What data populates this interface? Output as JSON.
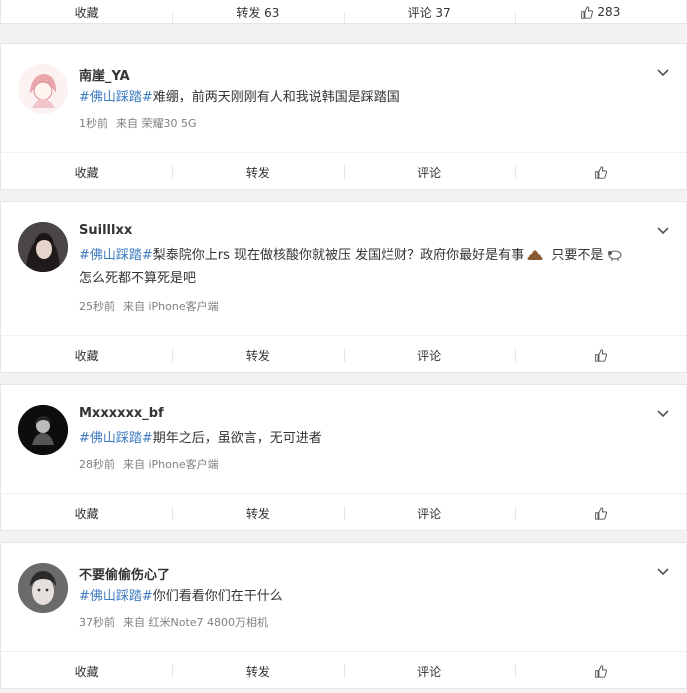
{
  "top_actions": {
    "favorite": "收藏",
    "repost": "转发 63",
    "comment": "评论 37",
    "like": "283"
  },
  "posts": [
    {
      "username": "南崖_YA",
      "hashtag": "#佛山踩踏#",
      "text": "难绷，前两天刚刚有人和我说韩国是踩踏国",
      "text2": "",
      "time": "1秒前",
      "source": "来自 荣耀30 5G",
      "actions": {
        "favorite": "收藏",
        "repost": "转发",
        "comment": "评论"
      }
    },
    {
      "username": "Suilllxx",
      "hashtag": "#佛山踩踏#",
      "text": "梨泰院你上rs 现在做核酸你就被压 发国烂财？政府你最好是有事",
      "text_mid": " 只要不是",
      "text2": "怎么死都不算死是吧",
      "time": "25秒前",
      "source": "来自 iPhone客户端",
      "actions": {
        "favorite": "收藏",
        "repost": "转发",
        "comment": "评论"
      }
    },
    {
      "username": "Mxxxxxx_bf",
      "hashtag": "#佛山踩踏#",
      "text": "期年之后，虽欲言，无可进者",
      "text2": "",
      "time": "28秒前",
      "source": "来自 iPhone客户端",
      "actions": {
        "favorite": "收藏",
        "repost": "转发",
        "comment": "评论"
      }
    },
    {
      "username": "不要偷偷伤心了",
      "hashtag": "#佛山踩踏#",
      "text": "你们看看你们在干什么",
      "text2": "",
      "time": "37秒前",
      "source": "来自 红米Note7 4800万相机",
      "actions": {
        "favorite": "收藏",
        "repost": "转发",
        "comment": "评论"
      }
    }
  ],
  "colors": {
    "hashtag": "#3c7bbf",
    "meta": "#808080",
    "background": "#f2f2f5"
  }
}
